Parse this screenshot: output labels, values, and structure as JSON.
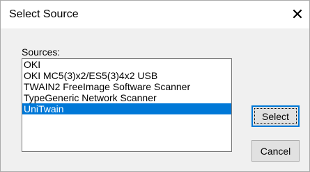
{
  "window": {
    "title": "Select Source",
    "close_glyph": "✕"
  },
  "sources": {
    "label": "Sources:",
    "items": [
      "OKI",
      "OKI MC5(3)x2/ES5(3)4x2 USB",
      "TWAIN2 FreeImage Software Scanner",
      "TypeGeneric Network Scanner",
      "UniTwain"
    ],
    "selected": "UniTwain"
  },
  "buttons": {
    "select": "Select",
    "cancel": "Cancel"
  },
  "colors": {
    "selection": "#0078d7"
  }
}
